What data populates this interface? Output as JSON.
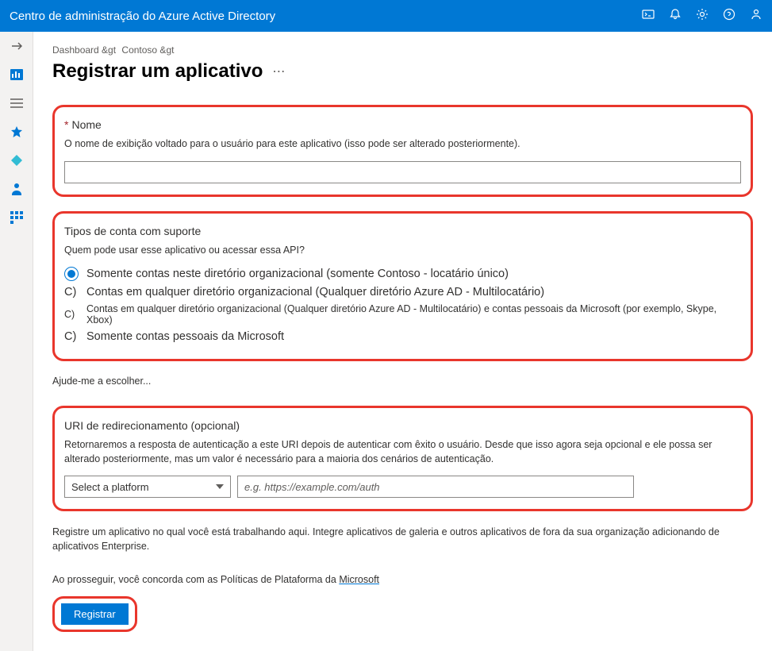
{
  "header": {
    "title": "Centro de administração do Azure Active Directory"
  },
  "breadcrumb": {
    "item1": "Dashboard &gt",
    "item2": "Contoso &gt"
  },
  "page": {
    "title": "Registrar um aplicativo"
  },
  "nameSection": {
    "label": "Nome",
    "desc": "O nome de exibição voltado para o usuário para este aplicativo (isso pode ser alterado posteriormente)."
  },
  "accountSection": {
    "title": "Tipos de conta com suporte",
    "question": "Quem pode usar esse aplicativo ou acessar essa API?",
    "opt1": "Somente contas neste diretório organizacional (somente Contoso - locatário único)",
    "opt2prefix": "C)",
    "opt2": "Contas em qualquer diretório organizacional (Qualquer diretório Azure AD - Multilocatário)",
    "opt3prefix": "C)",
    "opt3": "Contas em qualquer diretório organizacional (Qualquer diretório Azure AD - Multilocatário) e contas pessoais da Microsoft (por exemplo, Skype, Xbox)",
    "opt4prefix": "C)",
    "opt4": "Somente contas pessoais da Microsoft"
  },
  "helpLink": "Ajude-me a escolher...",
  "redirectSection": {
    "title": "URI de redirecionamento (opcional)",
    "desc": "Retornaremos a resposta de autenticação a este URI depois de autenticar com êxito o usuário. Desde que isso agora seja opcional e ele possa ser alterado posteriormente, mas um valor é necessário para a maioria dos cenários de autenticação.",
    "platformPlaceholder": "Select a platform",
    "uriPlaceholder": "e.g. https://example.com/auth"
  },
  "footerNote": "Registre um aplicativo no qual você está trabalhando aqui. Integre aplicativos de galeria e outros aplicativos de fora da sua organização adicionando de aplicativos Enterprise.",
  "policy": {
    "prefix": "Ao prosseguir, você concorda com as Políticas de Plataforma da ",
    "link": "Microsoft"
  },
  "registerButton": "Registrar"
}
